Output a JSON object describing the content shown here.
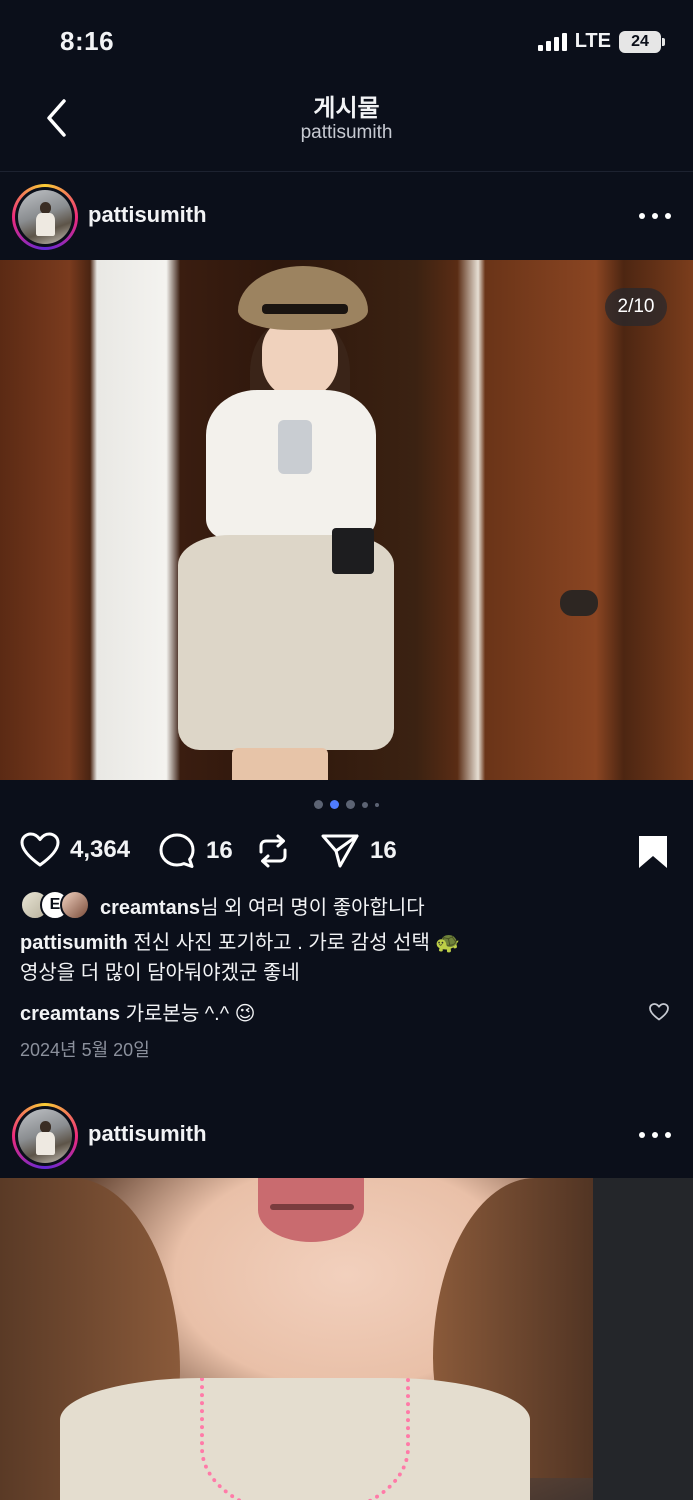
{
  "status": {
    "time": "8:16",
    "network": "LTE",
    "battery": "24"
  },
  "nav": {
    "title": "게시물",
    "subtitle": "pattisumith"
  },
  "post1": {
    "username": "pattisumith",
    "image_counter": "2/10",
    "likes": "4,364",
    "comments": "16",
    "shares": "16",
    "liked_by_user": "creamtans",
    "liked_by_suffix": "님 외 여러 명이 좋아합니다",
    "liked_avatar_letter": "E",
    "caption_user": "pattisumith",
    "caption_text": "전신 사진 포기하고 . 가로 감성 선택 🐢",
    "caption_text_line2": "영상을 더 많이 담아둬야겠군 좋네",
    "comment_user": "creamtans",
    "comment_text": "가로본능 ^.^ 😉",
    "date": "2024년 5월 20일"
  },
  "post2": {
    "username": "pattisumith"
  },
  "colors": {
    "background": "#0b0f1a",
    "accent_dot": "#4f7cff",
    "muted_text": "#8b909c"
  },
  "icons": [
    "back-icon",
    "more-icon",
    "heart-icon",
    "comment-icon",
    "repost-icon",
    "send-icon",
    "bookmark-icon"
  ]
}
